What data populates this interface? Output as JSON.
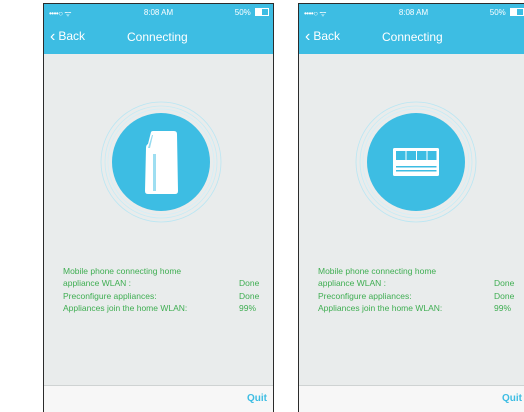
{
  "screens": [
    {
      "status": {
        "signal": "••••○",
        "wifi": "ᯤ",
        "time": "8:08 AM",
        "battery": "50%"
      },
      "nav": {
        "back_label": "Back",
        "title": "Connecting"
      },
      "device_icon": "portable-air-conditioner-icon",
      "progress": {
        "line1": "Mobile phone connecting home",
        "line2": "appliance WLAN :",
        "line2_value": "Done",
        "line3": "Preconfigure appliances:",
        "line3_value": "Done",
        "line4": "Appliances join the home WLAN:",
        "line4_value": "99%"
      },
      "quit_label": "Quit"
    },
    {
      "status": {
        "signal": "••••○",
        "wifi": "ᯤ",
        "time": "8:08 AM",
        "battery": "50%"
      },
      "nav": {
        "back_label": "Back",
        "title": "Connecting"
      },
      "device_icon": "window-air-conditioner-icon",
      "progress": {
        "line1": "Mobile phone connecting home",
        "line2": "appliance WLAN :",
        "line2_value": "Done",
        "line3": "Preconfigure appliances:",
        "line3_value": "Done",
        "line4": "Appliances join the home WLAN:",
        "line4_value": "99%"
      },
      "quit_label": "Quit"
    }
  ],
  "colors": {
    "accent": "#3dbde3",
    "status_text": "#3fae52",
    "background": "#e9ecec",
    "bottom_bar": "#f7f7f7"
  }
}
